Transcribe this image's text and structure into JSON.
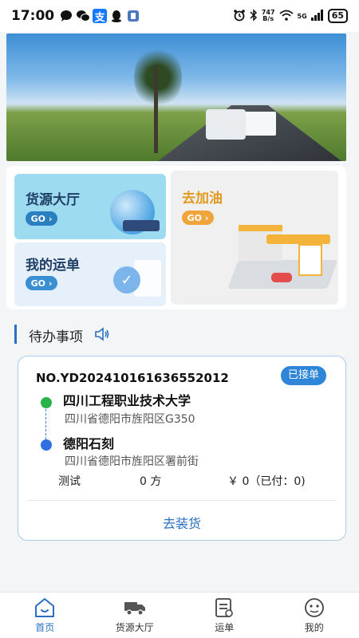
{
  "status_bar": {
    "time": "17:00",
    "app_icons": [
      "chat-icon",
      "wechat-icon",
      "alipay-icon",
      "qq-icon",
      "app-icon"
    ],
    "alipay_label": "支",
    "net_speed_value": "747",
    "net_speed_unit": "B/s",
    "signal_label": "5G",
    "battery": "65"
  },
  "quick_actions": {
    "cargo_hall": {
      "title": "货源大厅",
      "go": "GO"
    },
    "my_orders": {
      "title": "我的运单",
      "go": "GO"
    },
    "refuel": {
      "title": "去加油",
      "go": "GO"
    }
  },
  "todo": {
    "title": "待办事项"
  },
  "order": {
    "number": "NO.YD20241016163655​2012",
    "status": "已接单",
    "origin_name": "四川工程职业技术大学",
    "origin_address": "四川省德阳市旌阳区G350",
    "destination_name": "德阳石刻",
    "destination_address": "四川省德阳市旌阳区署前街",
    "goods": "测试",
    "volume": "0 方",
    "price": "￥ 0（已付：0)",
    "action": "去装货"
  },
  "tabs": [
    {
      "label": "首页",
      "icon": "home-icon",
      "active": true
    },
    {
      "label": "货源大厅",
      "icon": "truck-icon",
      "active": false
    },
    {
      "label": "运单",
      "icon": "waybill-icon",
      "active": false
    },
    {
      "label": "我的",
      "icon": "profile-icon",
      "active": false
    }
  ],
  "colors": {
    "primary": "#2a6fc0",
    "badge": "#2f86d8",
    "refuel_accent": "#e29a1e",
    "start_dot": "#27b24a",
    "end_dot": "#2f6fe0"
  }
}
